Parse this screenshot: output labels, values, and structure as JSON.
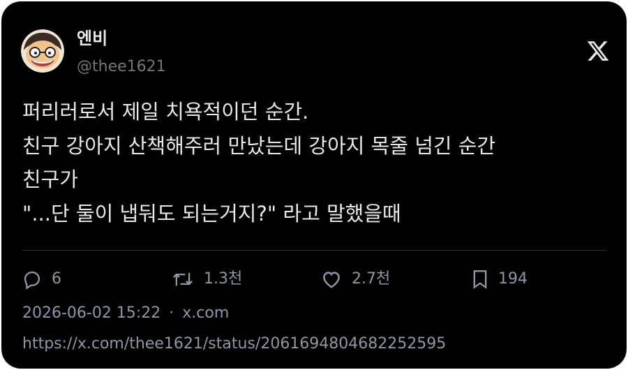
{
  "author": {
    "display_name": "엔비",
    "handle": "@thee1621"
  },
  "platform_icon": "x-logo-icon",
  "tweet": {
    "lines": [
      "퍼리러로서 제일 치욕적이던 순간.",
      "친구 강아지 산책해주러 만났는데 강아지 목줄 넘긴 순간",
      "친구가",
      "\"...단 둘이 냅둬도 되는거지?\" 라고 말했을때"
    ]
  },
  "actions": {
    "reply": {
      "icon": "reply-icon",
      "count": "6"
    },
    "retweet": {
      "icon": "retweet-icon",
      "count": "1.3천"
    },
    "like": {
      "icon": "heart-icon",
      "count": "2.7천"
    },
    "bookmark": {
      "icon": "bookmark-icon",
      "count": "194"
    }
  },
  "meta": {
    "timestamp": "2026-06-02 15:22",
    "separator": "·",
    "source": "x.com"
  },
  "status_url": "https://x.com/thee1621/status/2061694804682252595",
  "colors": {
    "background": "#000000",
    "text_primary": "#e7e9ea",
    "text_secondary": "#8b98a5",
    "divider": "#2f3336"
  }
}
